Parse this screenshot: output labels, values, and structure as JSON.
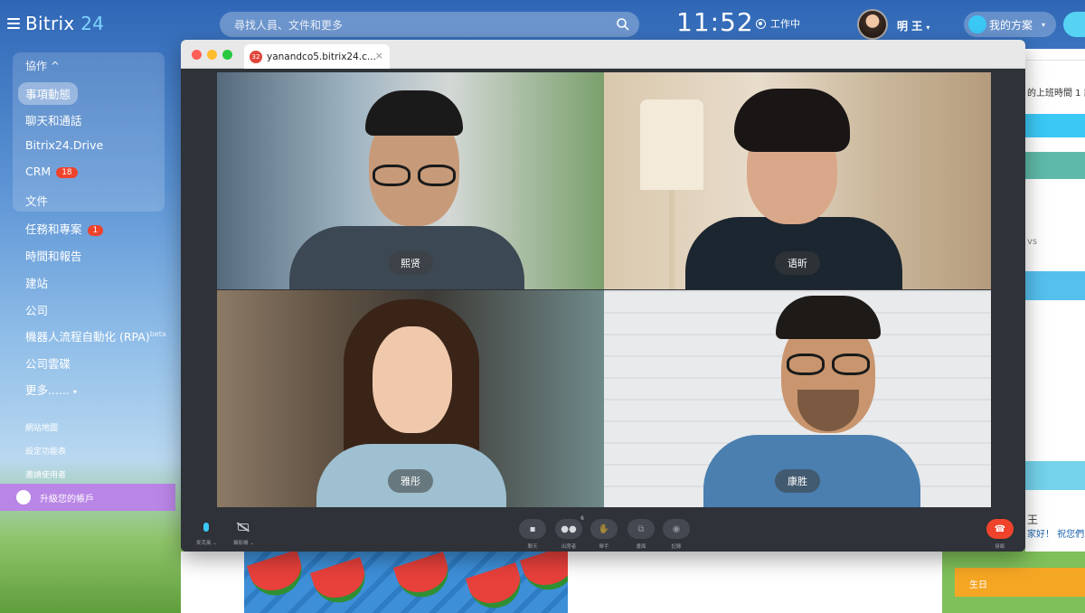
{
  "app": {
    "logo_name": "Bitrix",
    "logo_num": "24"
  },
  "topbar": {
    "search_placeholder": "尋找人員、文件和更多",
    "clock": "11:52",
    "work_status": "工作中",
    "user_name": "明 王",
    "user_chevron": "▾",
    "plan_label": "我的方案",
    "plan_chevron": "▾"
  },
  "sidebar": {
    "group_label": "協作 ^",
    "items": [
      {
        "label": "事項動態"
      },
      {
        "label": "聊天和通話"
      },
      {
        "label": "Bitrix24.Drive"
      },
      {
        "label": "CRM",
        "badge": "18"
      },
      {
        "label": "文件"
      },
      {
        "label": "任務和專案",
        "badge": "1"
      },
      {
        "label": "時間和報告"
      },
      {
        "label": "建站"
      },
      {
        "label": "公司"
      },
      {
        "label": "機器人流程自動化 (RPA)",
        "sup": "beta"
      },
      {
        "label": "公司雲碟"
      },
      {
        "label": "更多......",
        "chevron": "▾"
      }
    ],
    "small_links": [
      "網站地圖",
      "設定功能表",
      "邀請使用者"
    ],
    "upgrade_label": "升級您的帳戶"
  },
  "background": {
    "right_text_1": "的上班時間 1  記",
    "right_text_2": "vs",
    "right_text_3": "王",
    "right_text_4": "家好！ 祝您們",
    "birthday_label": "生日"
  },
  "browser": {
    "tab_badge": "32",
    "tab_title": "yanandco5.bitrix24.c...",
    "tab_close": "×"
  },
  "participants": [
    {
      "name": "熙贤"
    },
    {
      "name": "语昕"
    },
    {
      "name": "雅彤"
    },
    {
      "name": "康胜"
    }
  ],
  "controls": {
    "mic_label": "麥克風",
    "mic_chevron": "⌄",
    "camera_label": "攝影機",
    "camera_chevron": "⌄",
    "chat_label": "聊天",
    "participants_label": "出席者",
    "participants_count": "6",
    "raise_hand_label": "舉手",
    "share_label": "畫面",
    "record_label": "記錄",
    "hangup_label": "掛斷"
  },
  "colors": {
    "accent": "#3bc8f5",
    "badge_red": "#f0432c",
    "upgrade_purple": "#b985e6",
    "control_bg": "#2f3238"
  }
}
